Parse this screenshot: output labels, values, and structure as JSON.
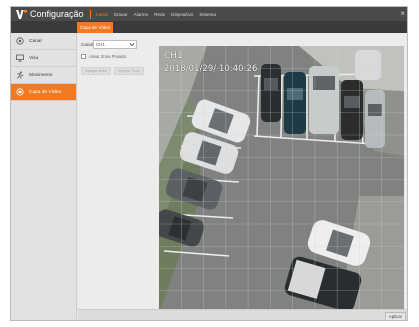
{
  "header": {
    "title": "Configuração",
    "nav": [
      "Canal",
      "Gravar",
      "Alarme",
      "Rede",
      "Dispositivo",
      "Sistema"
    ],
    "active_nav": 0,
    "close_glyph": "×"
  },
  "subtab": {
    "label": "Capa de Vídeo"
  },
  "sidebar": {
    "items": [
      {
        "label": "Canal",
        "icon": "camera-icon"
      },
      {
        "label": "Visu",
        "icon": "display-icon"
      },
      {
        "label": "Movimento",
        "icon": "motion-icon"
      },
      {
        "label": "Capa de Vídeo",
        "icon": "mask-icon"
      }
    ],
    "active_index": 3
  },
  "form": {
    "channel_label": "Canal",
    "channel_value": "CH1",
    "enable_label": "Ativar Zona Privada",
    "enable_checked": false,
    "clear_area_label": "Apagar Área",
    "clear_all_label": "Limpar Tudo"
  },
  "video": {
    "channel_overlay": "CH1",
    "datetime_overlay": "2018/01/29/  10:40:26"
  },
  "footer": {
    "apply_label": "Aplicar"
  },
  "colors": {
    "accent": "#f07a22",
    "titlebar": "#4a4a4a",
    "subtabbar": "#3a3a3a"
  }
}
